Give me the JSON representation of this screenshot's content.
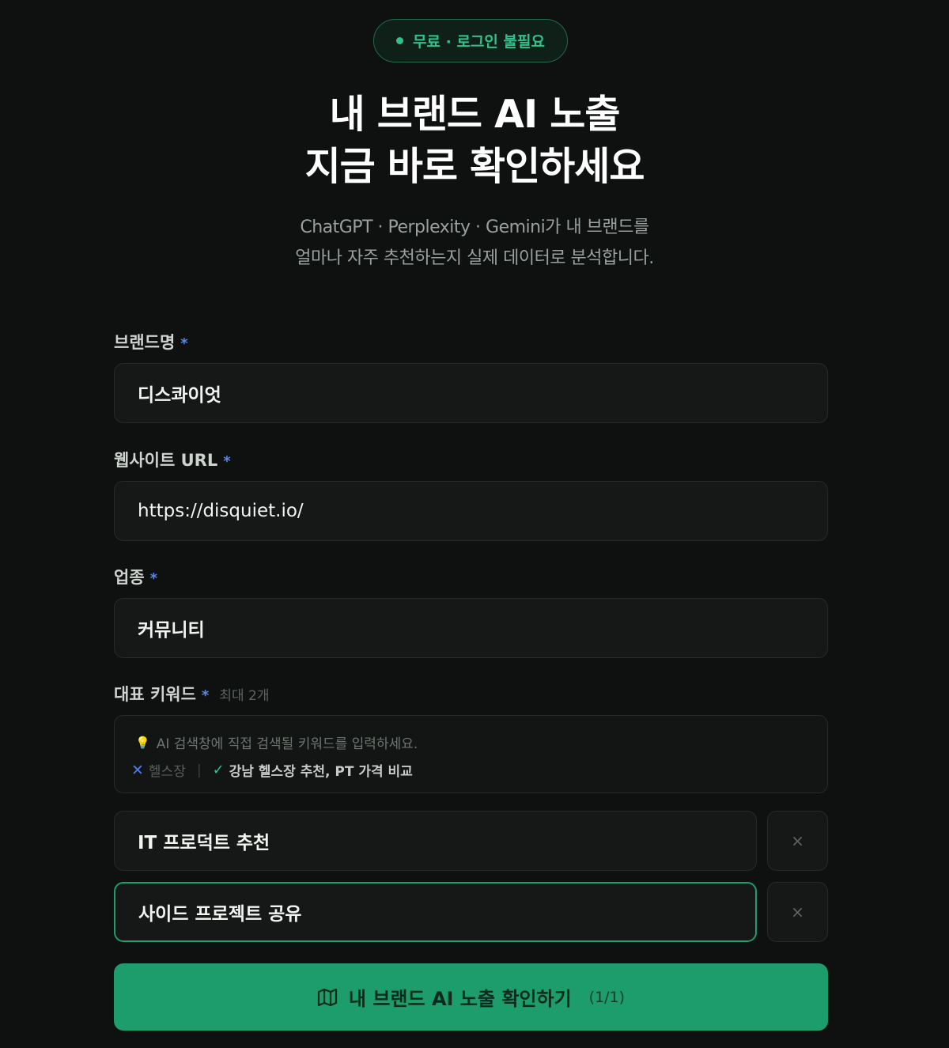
{
  "badge": {
    "text": "무료 · 로그인 불필요"
  },
  "hero": {
    "title_line1": "내 브랜드 AI 노출",
    "title_line2": "지금 바로 확인하세요",
    "subtitle_line1": "ChatGPT · Perplexity · Gemini가 내 브랜드를",
    "subtitle_line2": "얼마나 자주 추천하는지 실제 데이터로 분석합니다."
  },
  "form": {
    "brand": {
      "label": "브랜드명",
      "required_mark": "*",
      "value": "디스콰이엇"
    },
    "website": {
      "label": "웹사이트 URL",
      "required_mark": "*",
      "value": "https://disquiet.io/"
    },
    "industry": {
      "label": "업종",
      "required_mark": "*",
      "value": "커뮤니티"
    },
    "keywords": {
      "label": "대표 키워드",
      "required_mark": "*",
      "limit_hint": "최대 2개",
      "tip_text": "AI 검색창에 직접 검색될 키워드를 입력하세요.",
      "bad_example": "헬스장",
      "good_example": "강남 헬스장 추천, PT 가격 비교",
      "items": [
        "IT 프로덕트 추천",
        "사이드 프로젝트 공유"
      ],
      "remove_symbol": "×"
    }
  },
  "submit": {
    "label": "내 브랜드 AI 노출 확인하기",
    "count": "(1/1)",
    "icon": "map-icon"
  },
  "icons": {
    "tip": "lightbulb-icon",
    "bad": "cross-icon",
    "good": "check-icon"
  },
  "colors": {
    "background": "#0f1110",
    "accent": "#1d9c6c",
    "required": "#5a86e8"
  }
}
